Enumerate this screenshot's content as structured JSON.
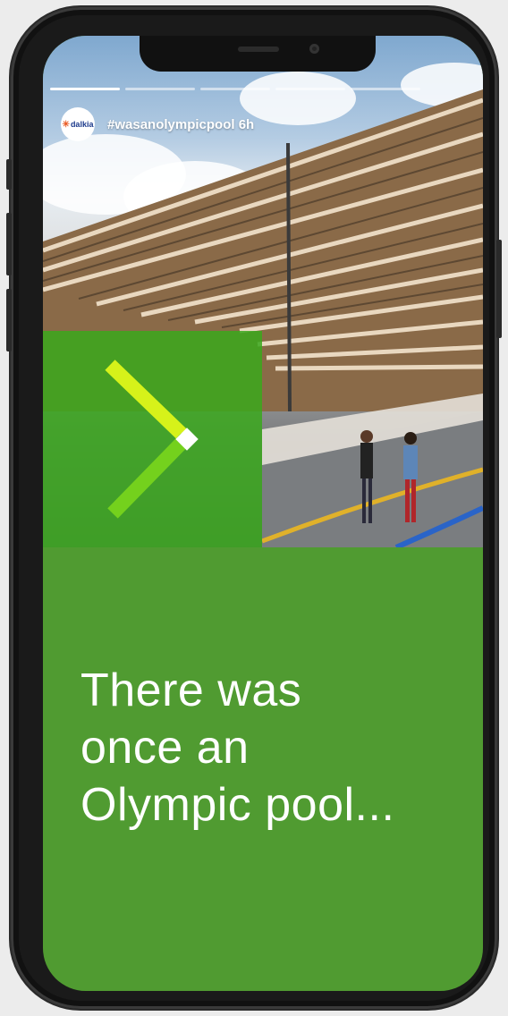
{
  "story": {
    "account_logo_text": "dalkia",
    "title": "#wasanolympicpool",
    "time_ago": "6h",
    "headline_lines": [
      "There was",
      "once an",
      "Olympic pool..."
    ],
    "progress_segments": 5,
    "progress_active": 1
  },
  "colors": {
    "brand_green": "#509b31",
    "panel_green": "#3aa81c",
    "chevron_yellow": "#d6f21a",
    "chevron_green": "#74d11d"
  },
  "icons": {
    "chevron": "right-chevron-icon"
  }
}
